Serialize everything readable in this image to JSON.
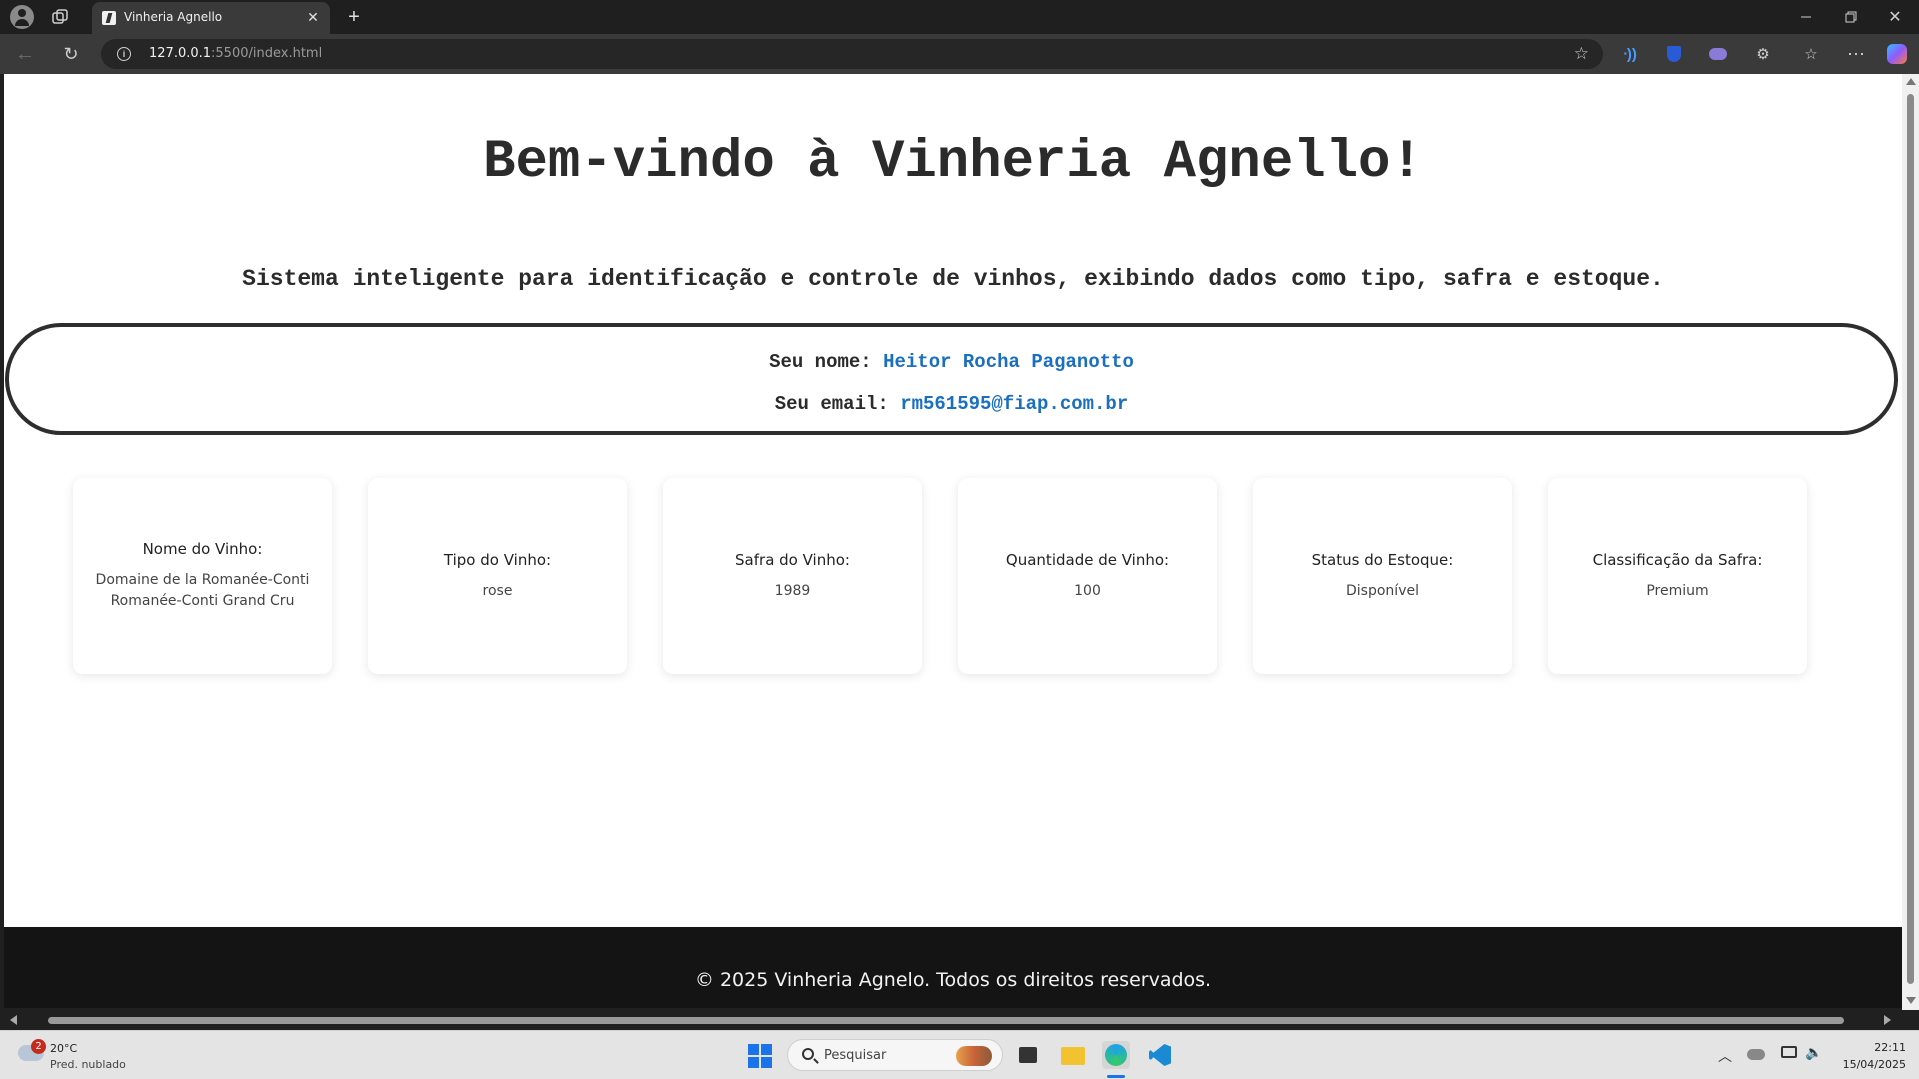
{
  "browser": {
    "tab_title": "Vinheria Agnello",
    "url_host": "127.0.0.1",
    "url_path": ":5500/index.html"
  },
  "page": {
    "title": "Bem-vindo à Vinheria Agnello!",
    "subtitle": "Sistema inteligente para identificação e controle de vinhos, exibindo dados como tipo, safra e estoque.",
    "user": {
      "name_label": "Seu nome:",
      "name_value": "Heitor Rocha Paganotto",
      "email_label": "Seu email:",
      "email_value": "rm561595@fiap.com.br"
    },
    "cards": [
      {
        "label": "Nome do Vinho:",
        "value": "Domaine de la Romanée-Conti Romanée-Conti Grand Cru"
      },
      {
        "label": "Tipo do Vinho:",
        "value": "rose"
      },
      {
        "label": "Safra do Vinho:",
        "value": "1989"
      },
      {
        "label": "Quantidade de Vinho:",
        "value": "100"
      },
      {
        "label": "Status do Estoque:",
        "value": "Disponível"
      },
      {
        "label": "Classificação da Safra:",
        "value": "Premium"
      }
    ],
    "footer": "© 2025 Vinheria Agnelo. Todos os direitos reservados."
  },
  "taskbar": {
    "weather_temp": "20°C",
    "weather_desc": "Pred. nublado",
    "weather_badge": "2",
    "search_placeholder": "Pesquisar",
    "time": "22:11",
    "date": "15/04/2025"
  },
  "colors": {
    "accent_link": "#1a6fc0",
    "footer_bg": "#141414",
    "page_text": "#2b2b2b"
  }
}
